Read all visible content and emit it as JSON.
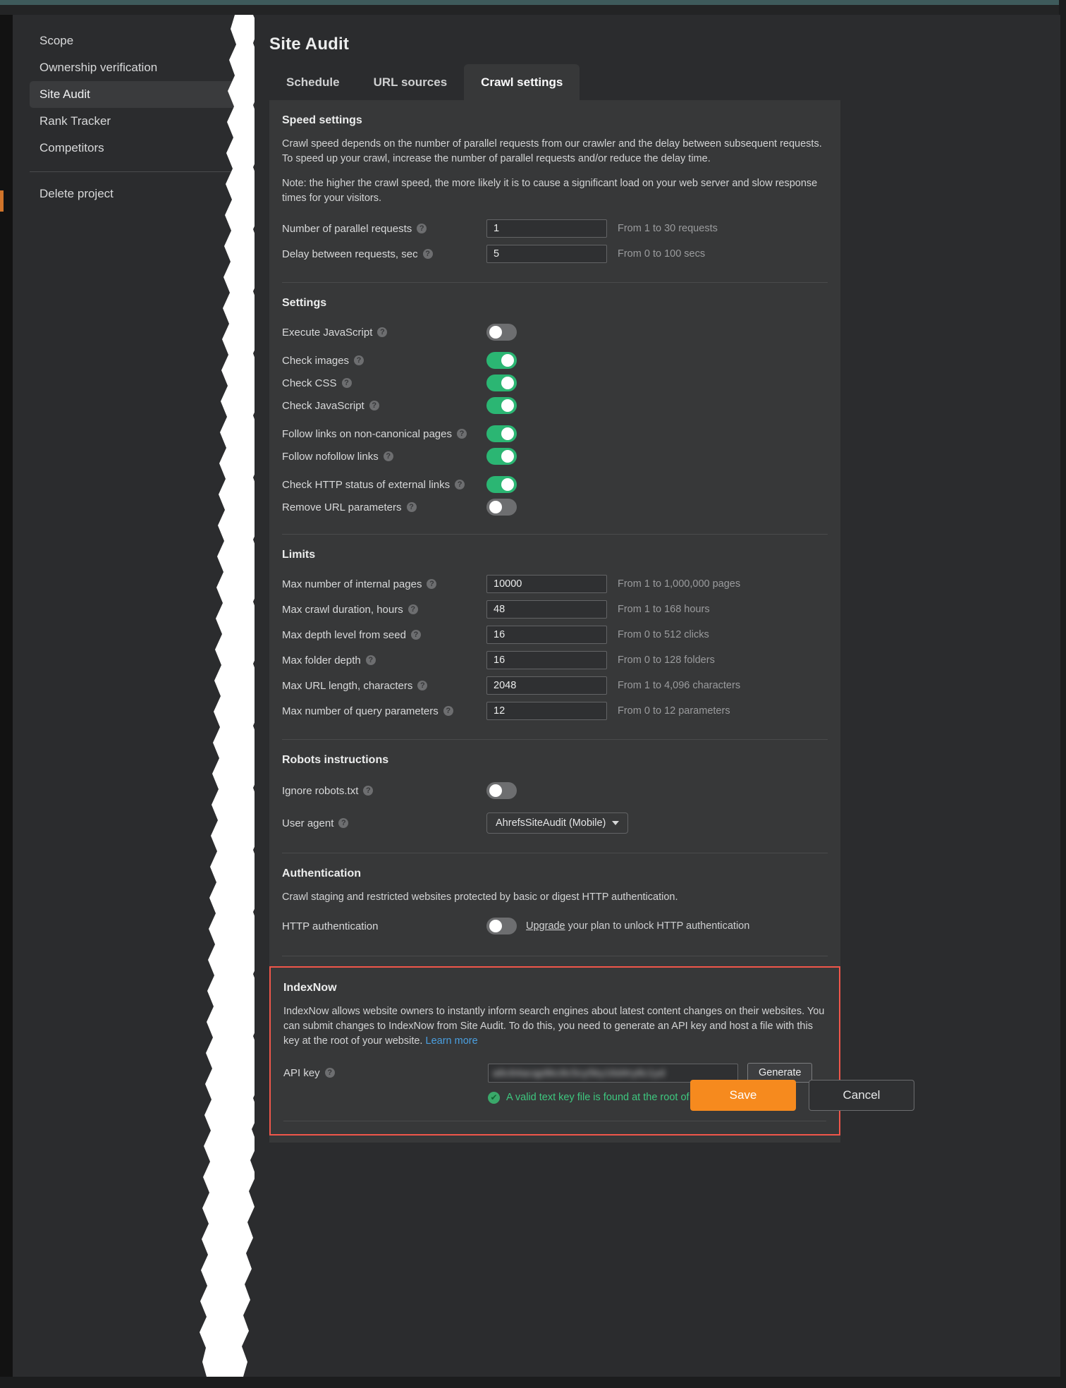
{
  "sidebar": {
    "items": [
      {
        "label": "Scope",
        "active": false
      },
      {
        "label": "Ownership verification",
        "active": false
      },
      {
        "label": "Site Audit",
        "active": true
      },
      {
        "label": "Rank Tracker",
        "active": false
      },
      {
        "label": "Competitors",
        "active": false
      }
    ],
    "delete_label": "Delete project"
  },
  "header": {
    "title": "Site Audit"
  },
  "tabs": [
    {
      "label": "Schedule",
      "active": false
    },
    {
      "label": "URL sources",
      "active": false
    },
    {
      "label": "Crawl settings",
      "active": true
    }
  ],
  "speed": {
    "title": "Speed settings",
    "paragraph1": "Crawl speed depends on the number of parallel requests from our crawler and the delay between subsequent requests. To speed up your crawl, increase the number of parallel requests and/or reduce the delay time.",
    "paragraph2": "Note: the higher the crawl speed, the more likely it is to cause a significant load on your web server and slow response times for your visitors.",
    "fields": [
      {
        "label": "Number of parallel requests",
        "value": "1",
        "hint": "From 1 to 30 requests",
        "help": "?"
      },
      {
        "label": "Delay between requests, sec",
        "value": "5",
        "hint": "From 0 to 100 secs",
        "help": "?"
      }
    ]
  },
  "settings": {
    "title": "Settings",
    "toggles": [
      {
        "label": "Execute JavaScript",
        "on": false,
        "help": "?"
      },
      {
        "label": "Check images",
        "on": true,
        "help": "?"
      },
      {
        "label": "Check CSS",
        "on": true,
        "help": "?"
      },
      {
        "label": "Check JavaScript",
        "on": true,
        "help": "?"
      },
      {
        "label": "Follow links on non-canonical pages",
        "on": true,
        "help": "?"
      },
      {
        "label": "Follow nofollow links",
        "on": true,
        "help": "?"
      },
      {
        "label": "Check HTTP status of external links",
        "on": true,
        "help": "?"
      },
      {
        "label": "Remove URL parameters",
        "on": false,
        "help": "?"
      }
    ]
  },
  "limits": {
    "title": "Limits",
    "fields": [
      {
        "label": "Max number of internal pages",
        "value": "10000",
        "hint": "From 1 to 1,000,000 pages",
        "help": "?"
      },
      {
        "label": "Max crawl duration, hours",
        "value": "48",
        "hint": "From 1 to 168 hours",
        "help": "?"
      },
      {
        "label": "Max depth level from seed",
        "value": "16",
        "hint": "From 0 to 512 clicks",
        "help": "?"
      },
      {
        "label": "Max folder depth",
        "value": "16",
        "hint": "From 0 to 128 folders",
        "help": "?"
      },
      {
        "label": "Max URL length, characters",
        "value": "2048",
        "hint": "From 1 to 4,096 characters",
        "help": "?"
      },
      {
        "label": "Max number of query parameters",
        "value": "12",
        "hint": "From 0 to 12 parameters",
        "help": "?"
      }
    ]
  },
  "robots": {
    "title": "Robots instructions",
    "ignore_label": "Ignore robots.txt",
    "ignore_on": false,
    "ignore_help": "?",
    "user_agent_label": "User agent",
    "user_agent_help": "?",
    "user_agent_value": "AhrefsSiteAudit (Mobile)"
  },
  "authentication": {
    "title": "Authentication",
    "description": "Crawl staging and restricted websites protected by basic or digest HTTP authentication.",
    "http_auth_label": "HTTP authentication",
    "http_auth_on": false,
    "upgrade_link": "Upgrade",
    "upgrade_rest": " your plan to unlock HTTP authentication"
  },
  "indexnow": {
    "title": "IndexNow",
    "description": "IndexNow allows website owners to instantly inform search engines about latest content changes on their websites. You can submit changes to IndexNow from Site Audit. To do this, you need to generate an API key and host a file with this key at the root of your website. ",
    "learn_more": "Learn more",
    "api_key_label": "API key",
    "api_key_help": "?",
    "api_key_value": "a8c64acqp8kc8c5cy5ky16d4ry8c1yd",
    "generate_label": "Generate",
    "valid_message": "A valid text key file is found at the root of your website.",
    "border_color": "#f0564a",
    "valid_color": "#3ec77f"
  },
  "footer": {
    "save_label": "Save",
    "cancel_label": "Cancel",
    "save_color": "#f68a1e"
  },
  "rail": {
    "translate_icon": "translate-icon",
    "apps_icon": "apps-grid-icon",
    "avatar_icon": "user-avatar"
  }
}
